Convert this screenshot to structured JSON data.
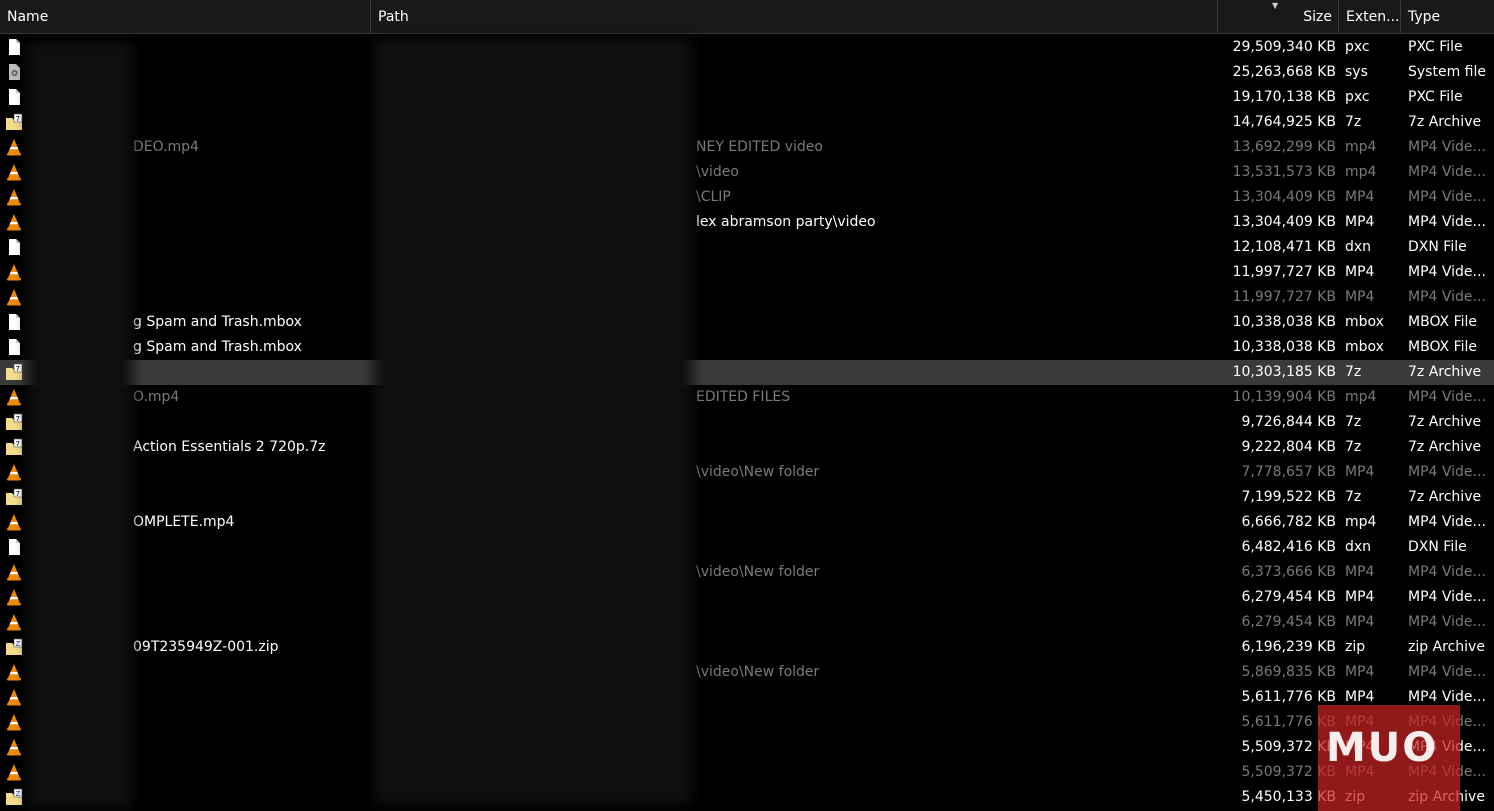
{
  "columns": {
    "name": "Name",
    "path": "Path",
    "size": "Size",
    "ext": "Exten...",
    "type": "Type"
  },
  "rows": [
    {
      "icon": "document-icon",
      "name": "",
      "path": "",
      "size": "29,509,340 KB",
      "ext": "pxc",
      "type": "PXC File",
      "dim": false
    },
    {
      "icon": "system-file-icon",
      "name": "",
      "path": "",
      "size": "25,263,668 KB",
      "ext": "sys",
      "type": "System file",
      "dim": false
    },
    {
      "icon": "document-icon",
      "name": "",
      "path": "",
      "size": "19,170,138 KB",
      "ext": "pxc",
      "type": "PXC File",
      "dim": false
    },
    {
      "icon": "archive-7z-icon",
      "name": "",
      "path": "",
      "size": "14,764,925 KB",
      "ext": "7z",
      "type": "7z Archive",
      "dim": false
    },
    {
      "icon": "vlc-icon",
      "name": "DEO.mp4",
      "path": "NEY EDITED video",
      "size": "13,692,299 KB",
      "ext": "mp4",
      "type": "MP4 Vide...",
      "dim": true
    },
    {
      "icon": "vlc-icon",
      "name": "",
      "path": "\\video",
      "size": "13,531,573 KB",
      "ext": "mp4",
      "type": "MP4 Vide...",
      "dim": true
    },
    {
      "icon": "vlc-icon",
      "name": "",
      "path": "\\CLIP",
      "size": "13,304,409 KB",
      "ext": "MP4",
      "type": "MP4 Vide...",
      "dim": true
    },
    {
      "icon": "vlc-icon",
      "name": "",
      "path": "lex abramson party\\video",
      "size": "13,304,409 KB",
      "ext": "MP4",
      "type": "MP4 Vide...",
      "dim": false
    },
    {
      "icon": "document-icon",
      "name": "",
      "path": "",
      "size": "12,108,471 KB",
      "ext": "dxn",
      "type": "DXN File",
      "dim": false
    },
    {
      "icon": "vlc-icon",
      "name": "",
      "path": "",
      "size": "11,997,727 KB",
      "ext": "MP4",
      "type": "MP4 Vide...",
      "dim": false
    },
    {
      "icon": "vlc-icon",
      "name": "",
      "path": "",
      "size": "11,997,727 KB",
      "ext": "MP4",
      "type": "MP4 Vide...",
      "dim": true
    },
    {
      "icon": "document-icon",
      "name": "g Spam and Trash.mbox",
      "path": "",
      "size": "10,338,038 KB",
      "ext": "mbox",
      "type": "MBOX File",
      "dim": false
    },
    {
      "icon": "document-icon",
      "name": "g Spam and Trash.mbox",
      "path": "",
      "size": "10,338,038 KB",
      "ext": "mbox",
      "type": "MBOX File",
      "dim": false
    },
    {
      "icon": "archive-7z-icon",
      "name": "",
      "path": "",
      "size": "10,303,185 KB",
      "ext": "7z",
      "type": "7z Archive",
      "dim": false,
      "selected": true
    },
    {
      "icon": "vlc-icon",
      "name": "O.mp4",
      "path": "EDITED FILES",
      "size": "10,139,904 KB",
      "ext": "mp4",
      "type": "MP4 Vide...",
      "dim": true
    },
    {
      "icon": "archive-7z-icon",
      "name": "",
      "path": "",
      "size": "9,726,844 KB",
      "ext": "7z",
      "type": "7z Archive",
      "dim": false
    },
    {
      "icon": "archive-7z-icon",
      "name": "Action Essentials 2 720p.7z",
      "path": "",
      "size": "9,222,804 KB",
      "ext": "7z",
      "type": "7z Archive",
      "dim": false
    },
    {
      "icon": "vlc-icon",
      "name": "",
      "path": "\\video\\New folder",
      "size": "7,778,657 KB",
      "ext": "MP4",
      "type": "MP4 Vide...",
      "dim": true
    },
    {
      "icon": "archive-7z-icon",
      "name": "",
      "path": "",
      "size": "7,199,522 KB",
      "ext": "7z",
      "type": "7z Archive",
      "dim": false
    },
    {
      "icon": "vlc-icon",
      "name": "OMPLETE.mp4",
      "path": "",
      "size": "6,666,782 KB",
      "ext": "mp4",
      "type": "MP4 Vide...",
      "dim": false
    },
    {
      "icon": "document-icon",
      "name": "",
      "path": "",
      "size": "6,482,416 KB",
      "ext": "dxn",
      "type": "DXN File",
      "dim": false
    },
    {
      "icon": "vlc-icon",
      "name": "",
      "path": "\\video\\New folder",
      "size": "6,373,666 KB",
      "ext": "MP4",
      "type": "MP4 Vide...",
      "dim": true
    },
    {
      "icon": "vlc-icon",
      "name": "",
      "path": "",
      "size": "6,279,454 KB",
      "ext": "MP4",
      "type": "MP4 Vide...",
      "dim": false
    },
    {
      "icon": "vlc-icon",
      "name": "",
      "path": "",
      "size": "6,279,454 KB",
      "ext": "MP4",
      "type": "MP4 Vide...",
      "dim": true
    },
    {
      "icon": "archive-zip-icon",
      "name": "09T235949Z-001.zip",
      "path": "",
      "size": "6,196,239 KB",
      "ext": "zip",
      "type": "zip Archive",
      "dim": false
    },
    {
      "icon": "vlc-icon",
      "name": "",
      "path": "\\video\\New folder",
      "size": "5,869,835 KB",
      "ext": "MP4",
      "type": "MP4 Vide...",
      "dim": true
    },
    {
      "icon": "vlc-icon",
      "name": "",
      "path": "",
      "size": "5,611,776 KB",
      "ext": "MP4",
      "type": "MP4 Vide...",
      "dim": false
    },
    {
      "icon": "vlc-icon",
      "name": "",
      "path": "",
      "size": "5,611,776 KB",
      "ext": "MP4",
      "type": "MP4 Vide...",
      "dim": true
    },
    {
      "icon": "vlc-icon",
      "name": "",
      "path": "",
      "size": "5,509,372 KB",
      "ext": "MP4",
      "type": "MP4 Vide...",
      "dim": false
    },
    {
      "icon": "vlc-icon",
      "name": "",
      "path": "",
      "size": "5,509,372 KB",
      "ext": "MP4",
      "type": "MP4 Vide...",
      "dim": true
    },
    {
      "icon": "archive-zip-icon",
      "name": "",
      "path": "",
      "size": "5,450,133 KB",
      "ext": "zip",
      "type": "zip Archive",
      "dim": false
    }
  ],
  "watermark": {
    "text": "MUO",
    "color": "#c82323"
  },
  "colors": {
    "background": "#000000",
    "header": "#191919",
    "selected": "#3a3a3a",
    "dim_text": "#7a7a7a"
  }
}
